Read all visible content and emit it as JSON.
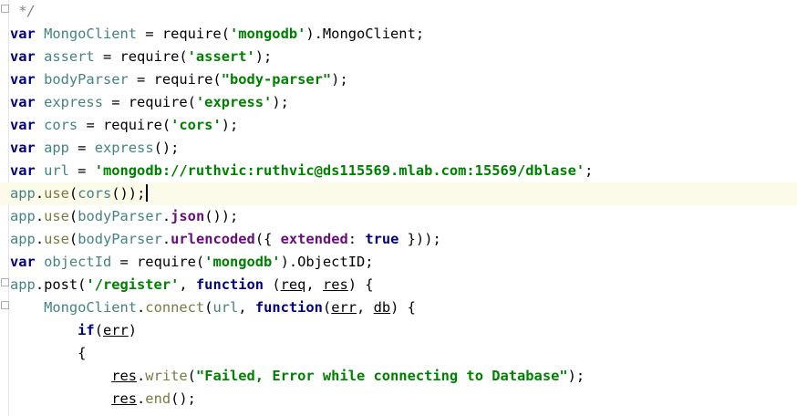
{
  "editor": {
    "lines": [
      [
        {
          "t": " */",
          "c": "cm"
        }
      ],
      [
        {
          "t": "var",
          "c": "kw"
        },
        {
          "t": " "
        },
        {
          "t": "MongoClient",
          "c": "v"
        },
        {
          "t": " = require("
        },
        {
          "t": "'mongodb'",
          "c": "str"
        },
        {
          "t": ").MongoClient;"
        }
      ],
      [
        {
          "t": "var",
          "c": "kw"
        },
        {
          "t": " "
        },
        {
          "t": "assert",
          "c": "v"
        },
        {
          "t": " = require("
        },
        {
          "t": "'assert'",
          "c": "str"
        },
        {
          "t": ");"
        }
      ],
      [
        {
          "t": "var",
          "c": "kw"
        },
        {
          "t": " "
        },
        {
          "t": "bodyParser",
          "c": "v"
        },
        {
          "t": " = require("
        },
        {
          "t": "\"body-parser\"",
          "c": "str"
        },
        {
          "t": ");"
        }
      ],
      [
        {
          "t": "var",
          "c": "kw"
        },
        {
          "t": " "
        },
        {
          "t": "express",
          "c": "v"
        },
        {
          "t": " = require("
        },
        {
          "t": "'express'",
          "c": "str"
        },
        {
          "t": ");"
        }
      ],
      [
        {
          "t": "var",
          "c": "kw"
        },
        {
          "t": " "
        },
        {
          "t": "cors",
          "c": "v"
        },
        {
          "t": " = require("
        },
        {
          "t": "'cors'",
          "c": "str"
        },
        {
          "t": ");"
        }
      ],
      [
        {
          "t": "var",
          "c": "kw"
        },
        {
          "t": " "
        },
        {
          "t": "app",
          "c": "v"
        },
        {
          "t": " = "
        },
        {
          "t": "express",
          "c": "v"
        },
        {
          "t": "();"
        }
      ],
      [
        {
          "t": "var",
          "c": "kw"
        },
        {
          "t": " "
        },
        {
          "t": "url",
          "c": "v"
        },
        {
          "t": " = "
        },
        {
          "t": "'mongodb://ruthvic:ruthvic@ds115569.mlab.com:15569/dblase'",
          "c": "str"
        },
        {
          "t": ";"
        }
      ],
      [
        {
          "t": "app",
          "c": "v"
        },
        {
          "t": "."
        },
        {
          "t": "use",
          "c": "fn"
        },
        {
          "t": "("
        },
        {
          "t": "cors",
          "c": "v"
        },
        {
          "t": "());"
        }
      ],
      [
        {
          "t": "app",
          "c": "v"
        },
        {
          "t": "."
        },
        {
          "t": "use",
          "c": "fn"
        },
        {
          "t": "("
        },
        {
          "t": "bodyParser",
          "c": "v"
        },
        {
          "t": "."
        },
        {
          "t": "json",
          "c": "prop"
        },
        {
          "t": "());"
        }
      ],
      [
        {
          "t": "app",
          "c": "v"
        },
        {
          "t": "."
        },
        {
          "t": "use",
          "c": "fn"
        },
        {
          "t": "("
        },
        {
          "t": "bodyParser",
          "c": "v"
        },
        {
          "t": "."
        },
        {
          "t": "urlencoded",
          "c": "prop"
        },
        {
          "t": "({ "
        },
        {
          "t": "extended",
          "c": "prop"
        },
        {
          "t": ": "
        },
        {
          "t": "true",
          "c": "kw"
        },
        {
          "t": " }));"
        }
      ],
      [
        {
          "t": "var",
          "c": "kw"
        },
        {
          "t": " "
        },
        {
          "t": "objectId",
          "c": "v"
        },
        {
          "t": " = require("
        },
        {
          "t": "'mongodb'",
          "c": "str"
        },
        {
          "t": ").ObjectID;"
        }
      ],
      [
        {
          "t": "app",
          "c": "v"
        },
        {
          "t": ".post("
        },
        {
          "t": "'/register'",
          "c": "str"
        },
        {
          "t": ", "
        },
        {
          "t": "function",
          "c": "kw"
        },
        {
          "t": " ("
        },
        {
          "t": "req",
          "c": "ul"
        },
        {
          "t": ", "
        },
        {
          "t": "res",
          "c": "ul"
        },
        {
          "t": ") {"
        }
      ],
      [
        {
          "t": "    "
        },
        {
          "t": "MongoClient",
          "c": "v"
        },
        {
          "t": "."
        },
        {
          "t": "connect",
          "c": "fn"
        },
        {
          "t": "("
        },
        {
          "t": "url",
          "c": "v"
        },
        {
          "t": ", "
        },
        {
          "t": "function",
          "c": "kw"
        },
        {
          "t": "("
        },
        {
          "t": "err",
          "c": "ul"
        },
        {
          "t": ", "
        },
        {
          "t": "db",
          "c": "ul"
        },
        {
          "t": ") {"
        }
      ],
      [
        {
          "t": "        "
        },
        {
          "t": "if",
          "c": "kw"
        },
        {
          "t": "("
        },
        {
          "t": "err",
          "c": "ul"
        },
        {
          "t": ")"
        }
      ],
      [
        {
          "t": "        {"
        }
      ],
      [
        {
          "t": "            "
        },
        {
          "t": "res",
          "c": "ul"
        },
        {
          "t": "."
        },
        {
          "t": "write",
          "c": "fn"
        },
        {
          "t": "("
        },
        {
          "t": "\"Failed, Error while connecting to Database\"",
          "c": "str"
        },
        {
          "t": ");"
        }
      ],
      [
        {
          "t": "            "
        },
        {
          "t": "res",
          "c": "ul"
        },
        {
          "t": "."
        },
        {
          "t": "end",
          "c": "fn"
        },
        {
          "t": "();"
        }
      ]
    ]
  }
}
